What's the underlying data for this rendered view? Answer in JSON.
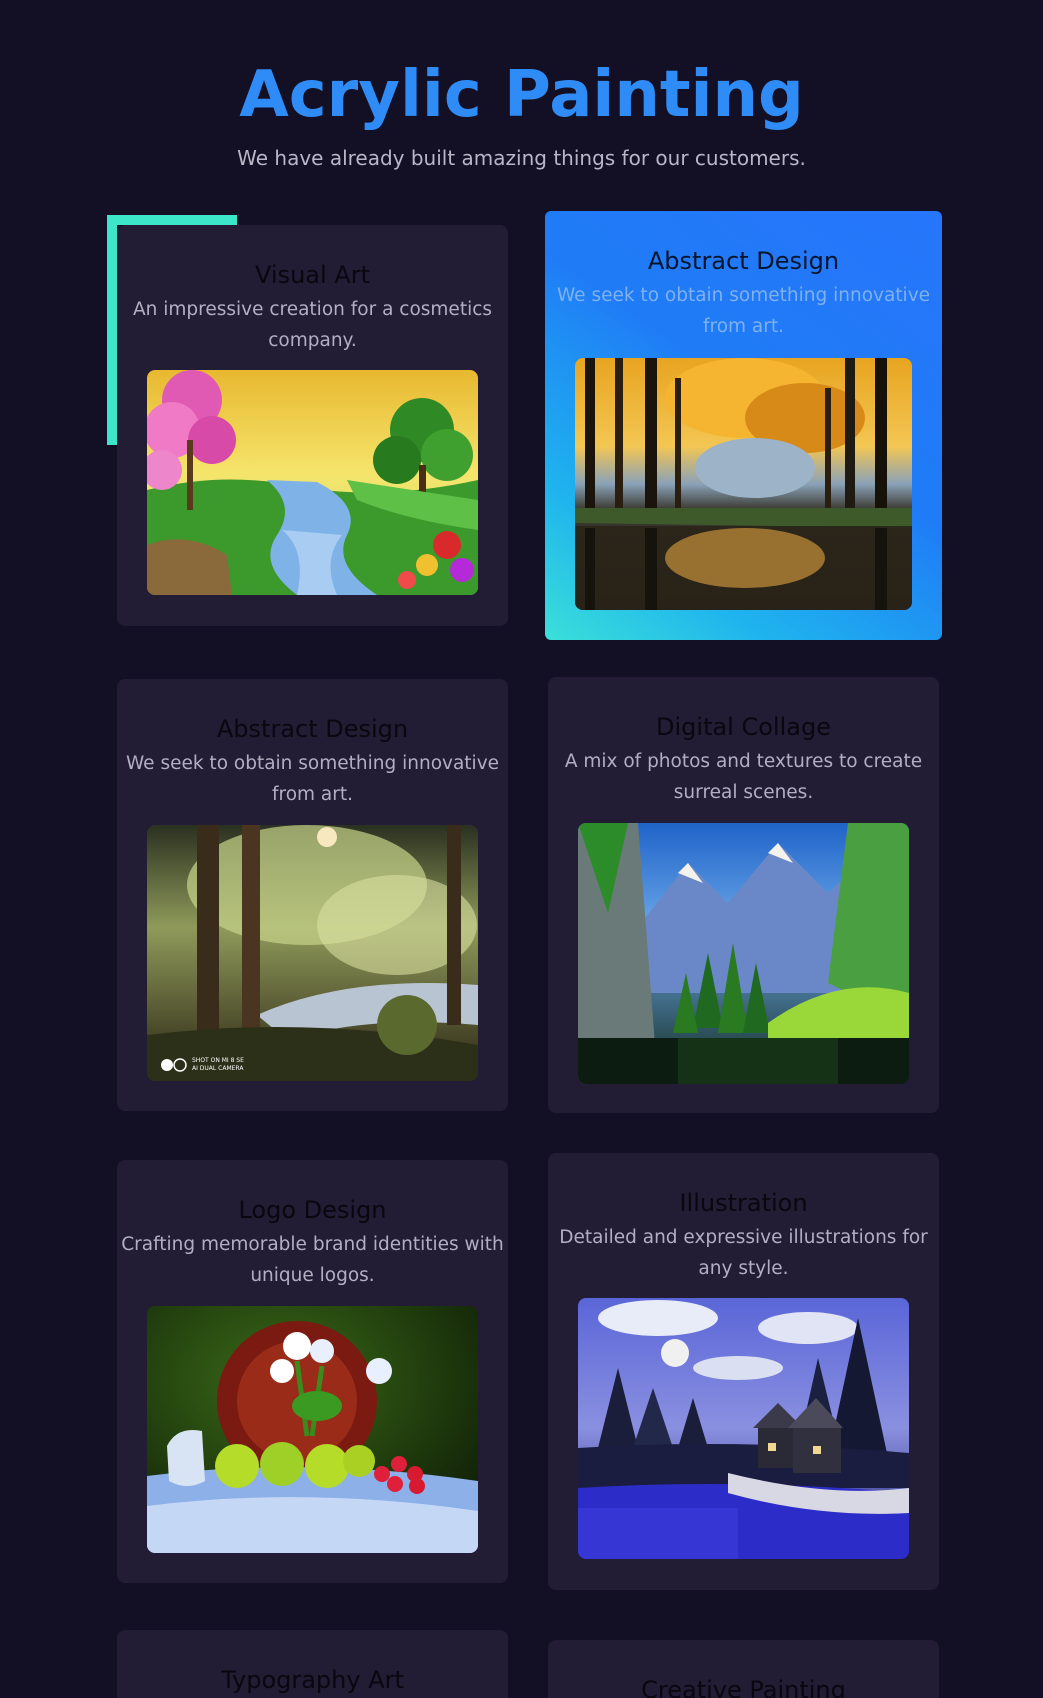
{
  "header": {
    "title": "Acrylic Painting",
    "subtitle": "We have already built amazing things for our customers."
  },
  "cards": [
    {
      "title": "Visual Art",
      "description": "An impressive creation for a cosmetics company.",
      "image": "river-landscape-painting"
    },
    {
      "title": "Abstract Design",
      "description": "We seek to obtain something innovative from art.",
      "image": "autumn-forest-lake-painting"
    },
    {
      "title": "Abstract Design",
      "description": "We seek to obtain something innovative from art.",
      "image": "sunlit-forest-river-painting",
      "watermark": "SHOT ON MI 8 SE\nAI DUAL CAMERA"
    },
    {
      "title": "Digital Collage",
      "description": "A mix of photos and textures to create surreal scenes.",
      "image": "mountain-lake-painting"
    },
    {
      "title": "Logo Design",
      "description": "Crafting memorable brand identities with unique logos.",
      "image": "fruit-still-life-painting"
    },
    {
      "title": "Illustration",
      "description": "Detailed and expressive illustrations for any style.",
      "image": "moonlit-cottage-painting"
    },
    {
      "title": "Typography Art"
    },
    {
      "title": "Creative Painting"
    }
  ],
  "colors": {
    "background": "#130f25",
    "card": "#221c34",
    "title_blue": "#2f8cf6",
    "accent_teal": "#3ee6c9"
  }
}
